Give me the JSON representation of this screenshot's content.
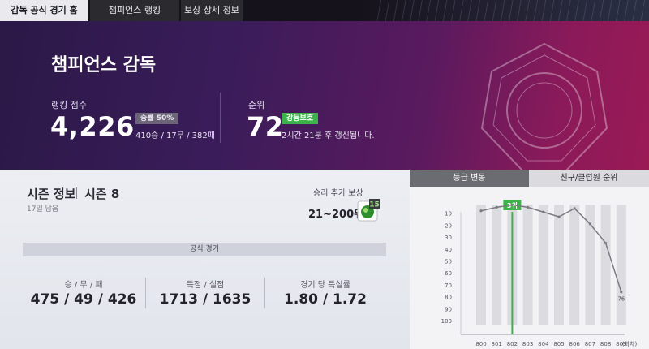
{
  "top_tabs": [
    "감독 공식 경기 홈",
    "챔피언스 랭킹",
    "보상 상세 정보"
  ],
  "hero": {
    "title": "챔피언스 감독",
    "ranking_points_label": "랭킹 점수",
    "ranking_points": "4,226",
    "win_rate_badge": "승률 50%",
    "record": "410승 / 17무 / 382패",
    "rank_label": "순위",
    "rank": "72",
    "rank_badge": "강등보호",
    "update_text": "2시간 21분 후 갱신됩니다."
  },
  "season": {
    "title": "시즌 정보",
    "number": "시즌 8",
    "days_left": "17일 남음",
    "reward_label": "승리 추가 보상",
    "reward_range": "21~200위",
    "reward_badge": "15",
    "section_title": "공식 경기",
    "stats": [
      {
        "label": "승 / 무 / 패",
        "value": "475 / 49 / 426"
      },
      {
        "label": "득점 / 실점",
        "value": "1713 / 1635"
      },
      {
        "label": "경기 당 득실률",
        "value": "1.80 / 1.72"
      }
    ]
  },
  "right_tabs": [
    "등급 변동",
    "친구/클럽원 순위"
  ],
  "chart_data": {
    "type": "line",
    "x": [
      "800",
      "801",
      "802",
      "803",
      "804",
      "805",
      "806",
      "807",
      "808",
      "809"
    ],
    "x_suffix": "(회차)",
    "y_ticks": [
      "10",
      "20",
      "30",
      "40",
      "50",
      "60",
      "70",
      "80",
      "90",
      "100"
    ],
    "values": [
      8,
      5,
      3,
      5,
      9,
      13,
      6,
      19,
      35,
      76
    ],
    "highlight_index": 2,
    "highlight_label": "3위",
    "end_label": "76",
    "ylim": [
      0,
      100
    ],
    "y_inverted": true,
    "colors": {
      "line": "#7a7a82",
      "highlight": "#3bb34a",
      "band": "#dcdce0"
    }
  }
}
